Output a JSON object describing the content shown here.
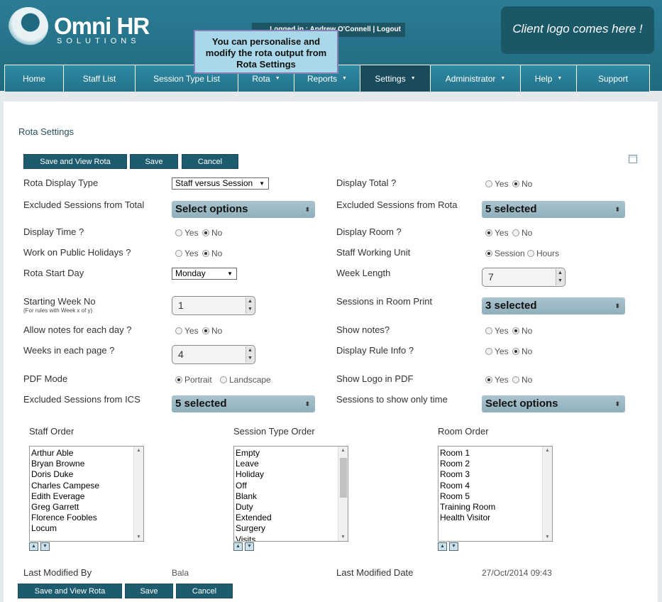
{
  "header": {
    "brand_name": "Omni HR",
    "brand_sub": "SOLUTIONS",
    "login_info": "Logged in : Andrew O'Connell | Logout",
    "tooltip": "You can personalise and modify the rota output from Rota Settings",
    "client_logo": "Client logo comes here !"
  },
  "nav": {
    "items": [
      {
        "label": "Home"
      },
      {
        "label": "Staff List"
      },
      {
        "label": "Session Type List"
      },
      {
        "label": "Rota"
      },
      {
        "label": "Reports"
      },
      {
        "label": "Settings"
      },
      {
        "label": "Administrator"
      },
      {
        "label": "Help"
      },
      {
        "label": "Support"
      }
    ]
  },
  "page": {
    "title": "Rota Settings"
  },
  "buttons": {
    "save_view": "Save and View Rota",
    "save": "Save",
    "cancel": "Cancel"
  },
  "form": {
    "rota_display_type": {
      "label": "Rota Display Type",
      "value": "Staff versus Session"
    },
    "display_total": {
      "label": "Display Total ?",
      "options": [
        "Yes",
        "No"
      ],
      "selected": "No"
    },
    "excluded_total": {
      "label": "Excluded Sessions from Total",
      "value": "Select options"
    },
    "excluded_rota": {
      "label": "Excluded Sessions from Rota",
      "value": "5 selected"
    },
    "display_time": {
      "label": "Display Time ?",
      "options": [
        "Yes",
        "No"
      ],
      "selected": "No"
    },
    "display_room": {
      "label": "Display Room ?",
      "options": [
        "Yes",
        "No"
      ],
      "selected": "Yes"
    },
    "public_holidays": {
      "label": "Work on Public Holidays ?",
      "options": [
        "Yes",
        "No"
      ],
      "selected": "No"
    },
    "working_unit": {
      "label": "Staff Working Unit",
      "options": [
        "Session",
        "Hours"
      ],
      "selected": "Session"
    },
    "rota_start_day": {
      "label": "Rota Start Day",
      "value": "Monday"
    },
    "week_length": {
      "label": "Week Length",
      "value": "7"
    },
    "starting_week": {
      "label": "Starting Week No",
      "note": "(For rules with Week x of y)",
      "value": "1"
    },
    "sessions_room_print": {
      "label": "Sessions in Room Print",
      "value": "3 selected"
    },
    "allow_notes": {
      "label": "Allow notes for each day ?",
      "options": [
        "Yes",
        "No"
      ],
      "selected": "No"
    },
    "show_notes": {
      "label": "Show notes?",
      "options": [
        "Yes",
        "No"
      ],
      "selected": "No"
    },
    "weeks_per_page": {
      "label": "Weeks in each page ?",
      "value": "4"
    },
    "display_rule_info": {
      "label": "Display Rule Info ?",
      "options": [
        "Yes",
        "No"
      ],
      "selected": "No"
    },
    "pdf_mode": {
      "label": "PDF Mode",
      "options": [
        "Portrait",
        "Landscape"
      ],
      "selected": "Portrait"
    },
    "show_logo_pdf": {
      "label": "Show Logo in PDF",
      "options": [
        "Yes",
        "No"
      ],
      "selected": "Yes"
    },
    "excluded_ics": {
      "label": "Excluded Sessions from ICS",
      "value": "5 selected"
    },
    "sessions_only_time": {
      "label": "Sessions to show only time",
      "value": "Select options"
    }
  },
  "orders": {
    "staff": {
      "label": "Staff Order",
      "items": [
        "Arthur Able",
        "Bryan Browne",
        "Doris Duke",
        "Charles Campese",
        "Edith Everage",
        "Greg Garrett",
        "Florence Foobles",
        "Locum"
      ]
    },
    "session_type": {
      "label": "Session Type Order",
      "items": [
        "Empty",
        "Leave",
        "Holiday",
        "Off",
        "Blank",
        "Duty",
        "Extended",
        "Surgery",
        "Visits"
      ]
    },
    "room": {
      "label": "Room Order",
      "items": [
        "Room 1",
        "Room 2",
        "Room 3",
        "Room 4",
        "Room 5",
        "Training Room",
        "Health Visitor"
      ]
    }
  },
  "footer": {
    "last_modified_by": {
      "label": "Last Modified By",
      "value": "Bala"
    },
    "last_modified_date": {
      "label": "Last Modified Date",
      "value": "27/Oct/2014 09:43"
    }
  }
}
